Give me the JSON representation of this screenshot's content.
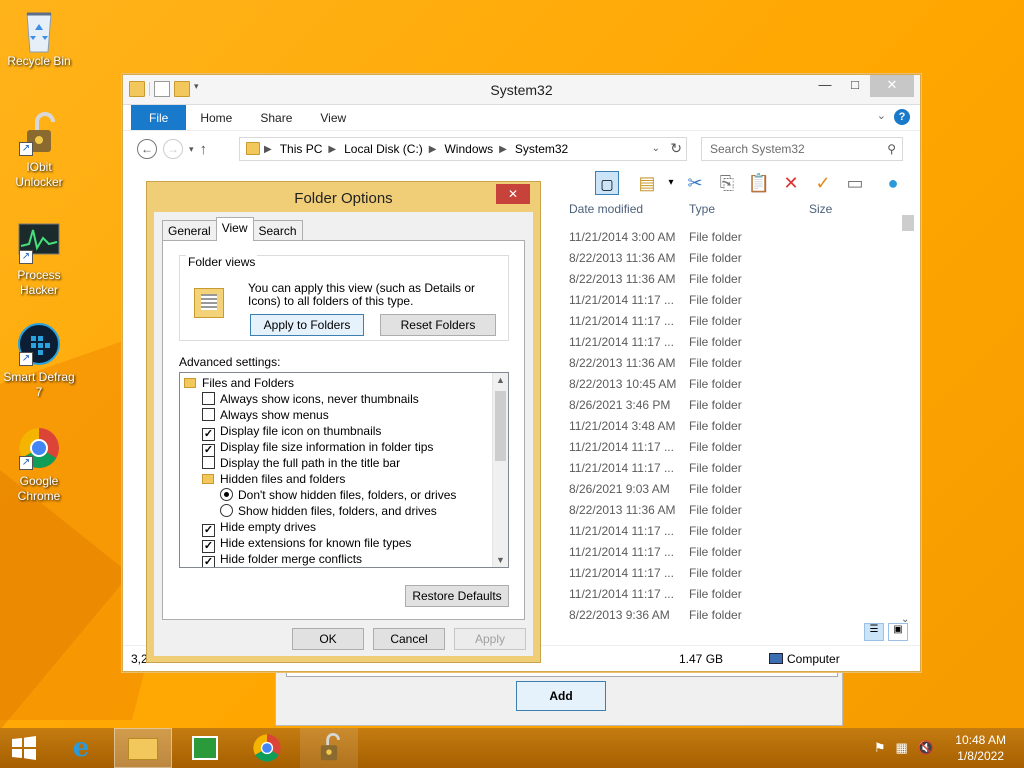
{
  "desktop": {
    "icons": [
      {
        "label": "Recycle Bin"
      },
      {
        "label": "IObit Unlocker"
      },
      {
        "label": "Process Hacker"
      },
      {
        "label": "Smart Defrag 7"
      },
      {
        "label": "Google Chrome"
      }
    ]
  },
  "bg_dialog": {
    "add_label": "Add"
  },
  "explorer": {
    "title": "System32",
    "ribbon_tabs": [
      "File",
      "Home",
      "Share",
      "View"
    ],
    "breadcrumb": [
      "This PC",
      "Local Disk (C:)",
      "Windows",
      "System32"
    ],
    "search_placeholder": "Search System32",
    "columns": {
      "date": "Date modified",
      "type": "Type",
      "size": "Size"
    },
    "rows": [
      {
        "date": "11/21/2014 3:00 AM",
        "type": "File folder"
      },
      {
        "date": "8/22/2013 11:36 AM",
        "type": "File folder"
      },
      {
        "date": "8/22/2013 11:36 AM",
        "type": "File folder"
      },
      {
        "date": "11/21/2014 11:17 ...",
        "type": "File folder"
      },
      {
        "date": "11/21/2014 11:17 ...",
        "type": "File folder"
      },
      {
        "date": "11/21/2014 11:17 ...",
        "type": "File folder"
      },
      {
        "date": "8/22/2013 11:36 AM",
        "type": "File folder"
      },
      {
        "date": "8/22/2013 10:45 AM",
        "type": "File folder"
      },
      {
        "date": "8/26/2021 3:46 PM",
        "type": "File folder"
      },
      {
        "date": "11/21/2014 3:48 AM",
        "type": "File folder"
      },
      {
        "date": "11/21/2014 11:17 ...",
        "type": "File folder"
      },
      {
        "date": "11/21/2014 11:17 ...",
        "type": "File folder"
      },
      {
        "date": "8/26/2021 9:03 AM",
        "type": "File folder"
      },
      {
        "date": "8/22/2013 11:36 AM",
        "type": "File folder"
      },
      {
        "date": "11/21/2014 11:17 ...",
        "type": "File folder"
      },
      {
        "date": "11/21/2014 11:17 ...",
        "type": "File folder"
      },
      {
        "date": "11/21/2014 11:17 ...",
        "type": "File folder"
      },
      {
        "date": "11/21/2014 11:17 ...",
        "type": "File folder"
      },
      {
        "date": "8/22/2013 9:36 AM",
        "type": "File folder"
      }
    ],
    "status": {
      "count": "3,2",
      "size": "1.47 GB",
      "location": "Computer"
    }
  },
  "folder_options": {
    "title": "Folder Options",
    "tabs": [
      "General",
      "View",
      "Search"
    ],
    "folder_views": {
      "label": "Folder views",
      "description": "You can apply this view (such as Details or Icons) to all folders of this type.",
      "apply_label": "Apply to Folders",
      "reset_label": "Reset Folders"
    },
    "advanced_label": "Advanced settings:",
    "tree": [
      {
        "kind": "folder",
        "label": "Files and Folders"
      },
      {
        "kind": "check",
        "checked": false,
        "label": "Always show icons, never thumbnails"
      },
      {
        "kind": "check",
        "checked": false,
        "label": "Always show menus"
      },
      {
        "kind": "check",
        "checked": true,
        "label": "Display file icon on thumbnails"
      },
      {
        "kind": "check",
        "checked": true,
        "label": "Display file size information in folder tips"
      },
      {
        "kind": "check",
        "checked": false,
        "label": "Display the full path in the title bar"
      },
      {
        "kind": "folder",
        "label": "Hidden files and folders"
      },
      {
        "kind": "radio",
        "checked": true,
        "label": "Don't show hidden files, folders, or drives"
      },
      {
        "kind": "radio",
        "checked": false,
        "label": "Show hidden files, folders, and drives"
      },
      {
        "kind": "check",
        "checked": true,
        "label": "Hide empty drives"
      },
      {
        "kind": "check",
        "checked": true,
        "label": "Hide extensions for known file types"
      },
      {
        "kind": "check",
        "checked": true,
        "label": "Hide folder merge conflicts"
      }
    ],
    "restore_label": "Restore Defaults",
    "ok_label": "OK",
    "cancel_label": "Cancel",
    "apply_label": "Apply"
  },
  "taskbar": {
    "time": "10:48 AM",
    "date": "1/8/2022"
  }
}
